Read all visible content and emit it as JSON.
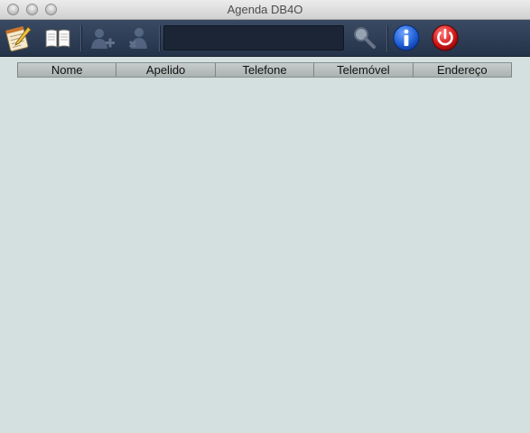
{
  "window": {
    "title": "Agenda DB4O"
  },
  "toolbar": {
    "buttons": [
      {
        "name": "new-contact",
        "icon": "notepad-pen-icon"
      },
      {
        "name": "open-book",
        "icon": "open-book-icon"
      },
      {
        "name": "add-person",
        "icon": "add-person-icon",
        "enabled": false
      },
      {
        "name": "remove-person",
        "icon": "remove-person-icon",
        "enabled": false
      },
      {
        "name": "search",
        "icon": "magnifier-icon"
      },
      {
        "name": "info",
        "icon": "info-icon"
      },
      {
        "name": "quit",
        "icon": "power-icon"
      }
    ],
    "search": {
      "value": "",
      "placeholder": ""
    }
  },
  "table": {
    "columns": [
      "Nome",
      "Apelido",
      "Telefone",
      "Telemóvel",
      "Endereço"
    ],
    "rows": []
  },
  "colors": {
    "background": "#d3e0df",
    "toolbar": "#2c3b53",
    "info_blue": "#1f5fd6",
    "power_red": "#d41616"
  }
}
